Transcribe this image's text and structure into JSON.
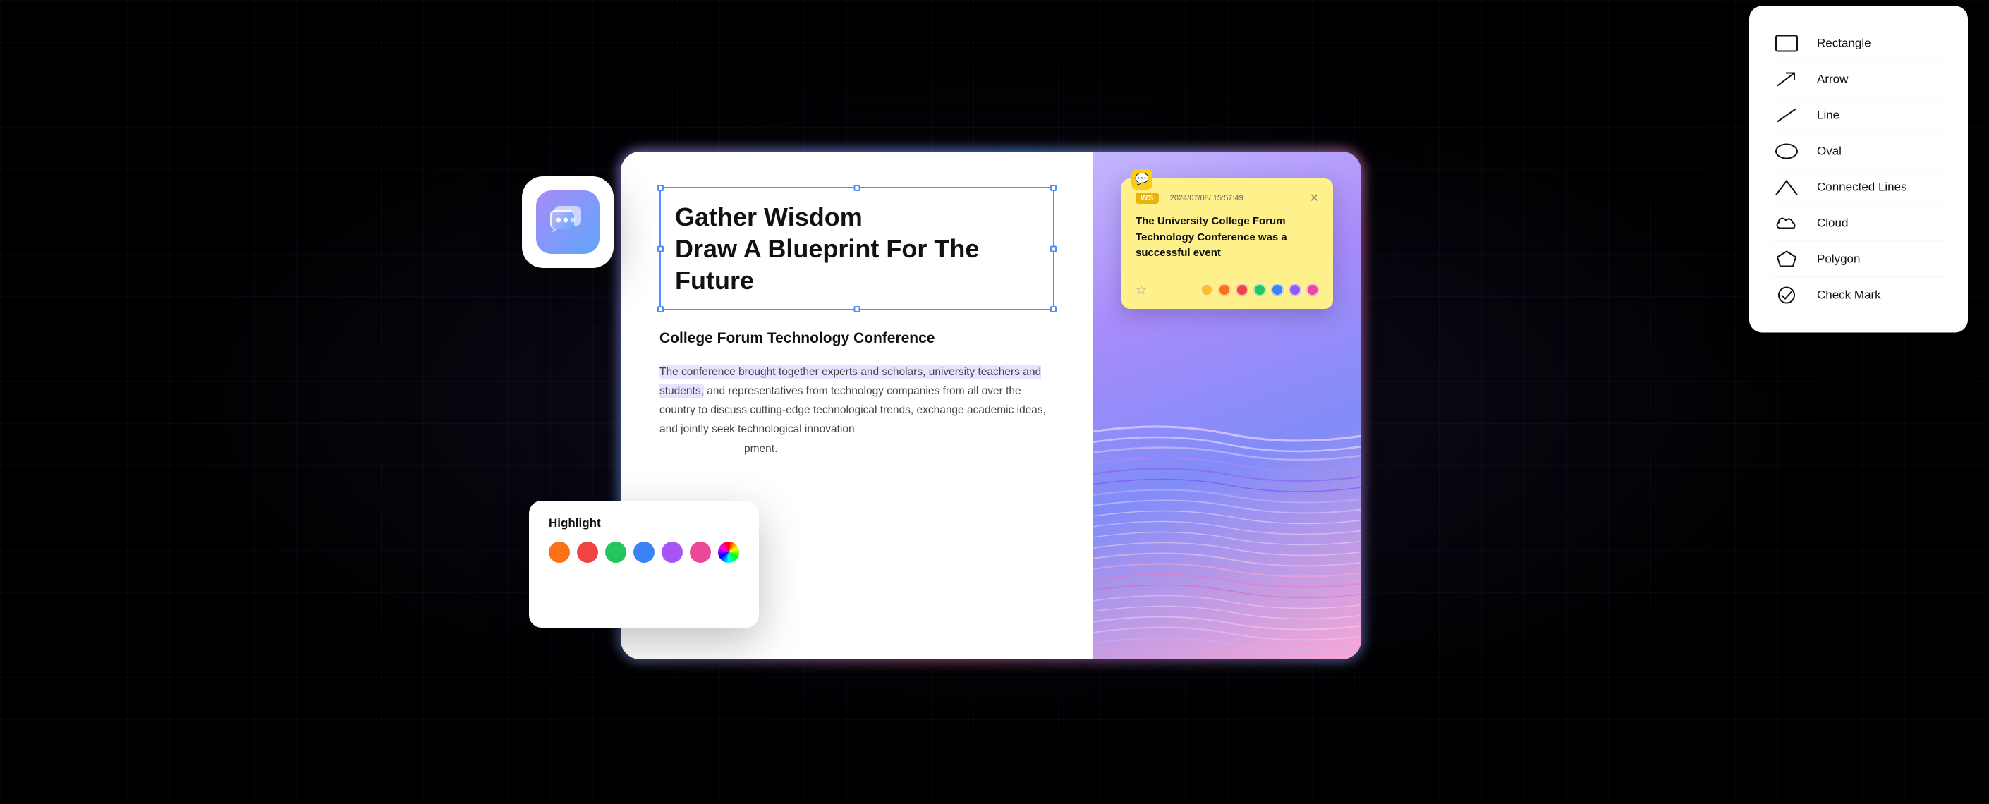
{
  "scene": {
    "title_text": "Gather Wisdom Draw A Blueprint For The Future",
    "section_title": "College Forum Technology Conference",
    "body_text_highlighted": "The conference brought together experts and scholars, university teachers and students,",
    "body_text_normal": " and representatives from technology companies from all over the country to discuss cutting-edge technological trends, exchange academic ideas, and jointly seek technological innovation",
    "body_text_end": "pment.",
    "note": {
      "tag": "WS",
      "timestamp": "2024/07/08/ 15:57:49",
      "text": "The University College Forum Technology Conference was a successful event",
      "icon": "💬"
    },
    "highlight_panel": {
      "title": "Highlight",
      "colors": [
        {
          "name": "orange",
          "hex": "#f97316"
        },
        {
          "name": "red",
          "hex": "#ef4444"
        },
        {
          "name": "green",
          "hex": "#22c55e"
        },
        {
          "name": "blue",
          "hex": "#3b82f6"
        },
        {
          "name": "purple",
          "hex": "#a855f7"
        },
        {
          "name": "pink",
          "hex": "#ec4899"
        },
        {
          "name": "rainbow",
          "hex": "conic"
        }
      ]
    },
    "note_colors": [
      "#fbbf24",
      "#f97316",
      "#ef4444",
      "#22c55e",
      "#3b82f6",
      "#8b5cf6",
      "#ec4899"
    ],
    "shapes_panel": {
      "items": [
        {
          "label": "Rectangle",
          "icon": "rectangle"
        },
        {
          "label": "Arrow",
          "icon": "arrow"
        },
        {
          "label": "Line",
          "icon": "line"
        },
        {
          "label": "Oval",
          "icon": "oval"
        },
        {
          "label": "Connected Lines",
          "icon": "connected-lines"
        },
        {
          "label": "Cloud",
          "icon": "cloud"
        },
        {
          "label": "Polygon",
          "icon": "polygon"
        },
        {
          "label": "Check Mark",
          "icon": "check-mark"
        }
      ]
    }
  }
}
